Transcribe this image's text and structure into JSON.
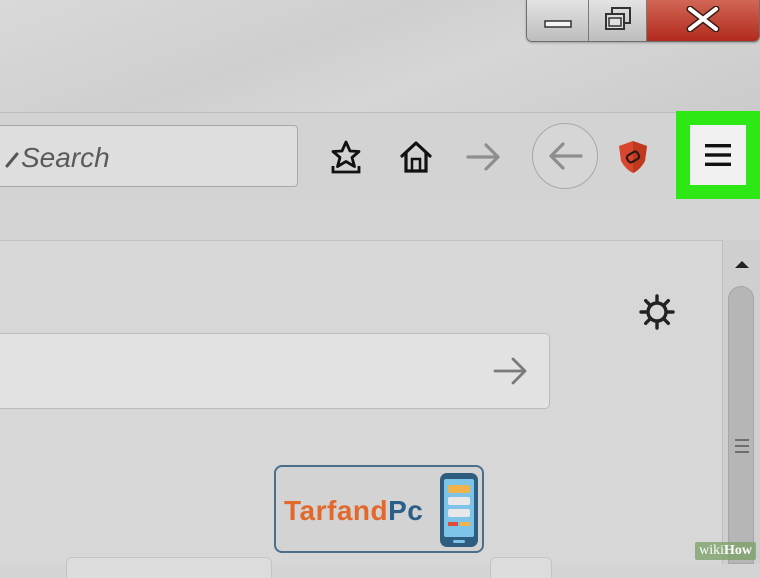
{
  "window": {
    "controls": [
      "minimize",
      "restore",
      "close"
    ]
  },
  "toolbar": {
    "search_placeholder": "Search",
    "icons": [
      "bookmarks-icon",
      "home-icon",
      "forward-icon",
      "back-icon",
      "shield-icon",
      "menu-icon"
    ],
    "menu_highlight_color": "#2ee815"
  },
  "content": {
    "settings_icon": "gear-icon",
    "go_icon": "arrow-right-icon"
  },
  "logo": {
    "part1": "Tarfand",
    "part2": "Pc"
  },
  "watermark": {
    "part1": "wiki",
    "part2": "How"
  }
}
